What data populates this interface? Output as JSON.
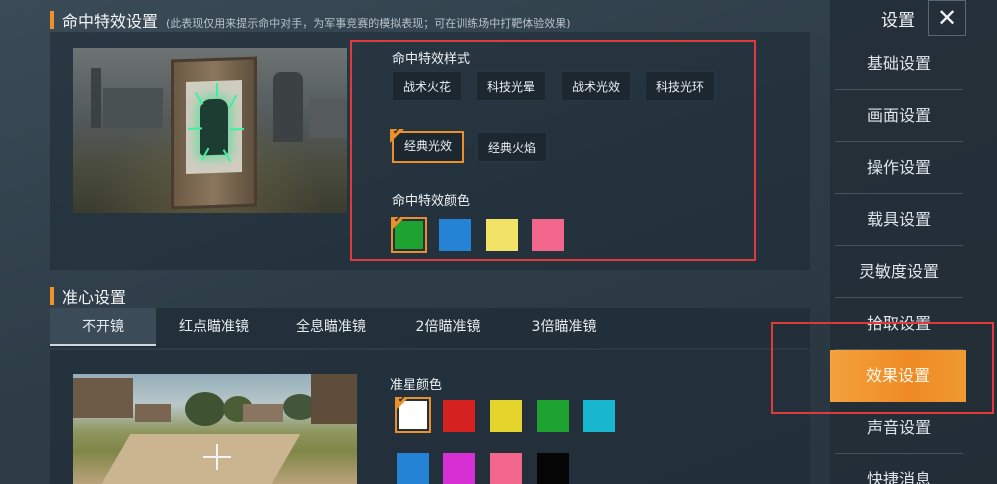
{
  "hit_effect_section": {
    "title": "命中特效设置",
    "subtitle": "(此表现仅用来提示命中对手，为军事竞赛的模拟表现；可在训练场中打靶体验效果)",
    "style_label": "命中特效样式",
    "styles": [
      "战术火花",
      "科技光晕",
      "战术光效",
      "科技光环",
      "经典光效",
      "经典火焰"
    ],
    "selected_style": "经典光效",
    "color_label": "命中特效颜色",
    "colors": [
      "#1fa330",
      "#2583d6",
      "#f2e266",
      "#f2668b"
    ],
    "selected_color": "#1fa330"
  },
  "crosshair_section": {
    "title": "准心设置",
    "tabs": [
      "不开镜",
      "红点瞄准镜",
      "全息瞄准镜",
      "2倍瞄准镜",
      "3倍瞄准镜"
    ],
    "active_tab": "不开镜",
    "color_label": "准星颜色",
    "colors": [
      "#ffffff",
      "#d62121",
      "#e5d42b",
      "#1fa330",
      "#18b7cf",
      "#2583d6",
      "#d62fd3",
      "#f2668b",
      "#050505"
    ],
    "selected_color": "#ffffff"
  },
  "sidebar": {
    "title": "设置",
    "close_icon": "close-icon",
    "items": [
      "基础设置",
      "画面设置",
      "操作设置",
      "载具设置",
      "灵敏度设置",
      "拾取设置",
      "效果设置",
      "声音设置",
      "快捷消息"
    ],
    "active_item": "效果设置"
  },
  "accent_color": "#f0922a",
  "highlight_color": "#e03a3a"
}
